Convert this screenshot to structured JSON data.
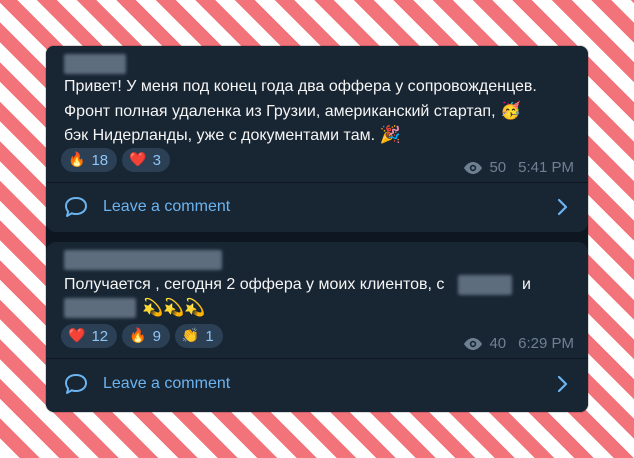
{
  "posts": [
    {
      "lines": [
        "Привет! У меня под конец года два оффера у сопровожденцев.",
        "Фронт полная удаленка из Грузии, американский стартап,",
        "бэк Нидерланды, уже с документами там."
      ],
      "emoji_line2": "🥳",
      "emoji_line3": "🎉",
      "reactions": [
        {
          "emoji": "🔥",
          "count": "18"
        },
        {
          "emoji": "❤️",
          "count": "3"
        }
      ],
      "views": "50",
      "time": "5:41 PM",
      "comment_label": "Leave a comment"
    },
    {
      "line1_prefix": "Получается , сегодня 2 оффера у моих клиентов, с",
      "line1_and": "и",
      "emoji_line2": "💫💫💫",
      "reactions": [
        {
          "emoji": "❤️",
          "count": "12"
        },
        {
          "emoji": "🔥",
          "count": "9"
        },
        {
          "emoji": "👏",
          "count": "1"
        }
      ],
      "views": "40",
      "time": "6:29 PM",
      "comment_label": "Leave a comment"
    }
  ],
  "colors": {
    "accent": "#6cb4f0",
    "bubble": "#182533",
    "chip": "#2b3f55",
    "meta": "#6e8194",
    "stripe": "#f2737a"
  },
  "icons": {
    "views": "eye-icon",
    "comment": "speech-bubble-icon",
    "chevron": "chevron-right-icon"
  }
}
